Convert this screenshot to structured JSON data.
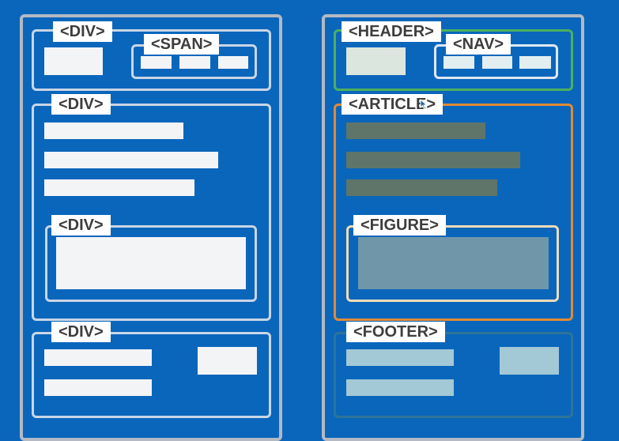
{
  "colors": {
    "background": "#0a66bb",
    "panel_border": "#b4b9c3",
    "generic_border": "#c9d6e6",
    "generic_block": "#f3f4f6",
    "header_border": "#4cb05c",
    "header_block": "#dbe7de",
    "nav_border": "#dfe8f2",
    "nav_block": "#e2eef0",
    "article_border": "#e08a36",
    "article_block": "#5f7569",
    "figure_border": "#efdcb8",
    "figure_block": "#7097a9",
    "footer_border": "#2d7498",
    "footer_block": "#a3c8d6"
  },
  "generic_layout": {
    "header_div_label": "<DIV>",
    "span_label": "<SPAN>",
    "content_div_label": "<DIV>",
    "inner_div_label": "<DIV>",
    "footer_div_label": "<DIV>"
  },
  "semantic_layout": {
    "header_label": "<HEADER>",
    "nav_label": "<NAV>",
    "article_label": "<ARTICLE>",
    "figure_label": "<FIGURE>",
    "footer_label": "<FOOTER>"
  }
}
